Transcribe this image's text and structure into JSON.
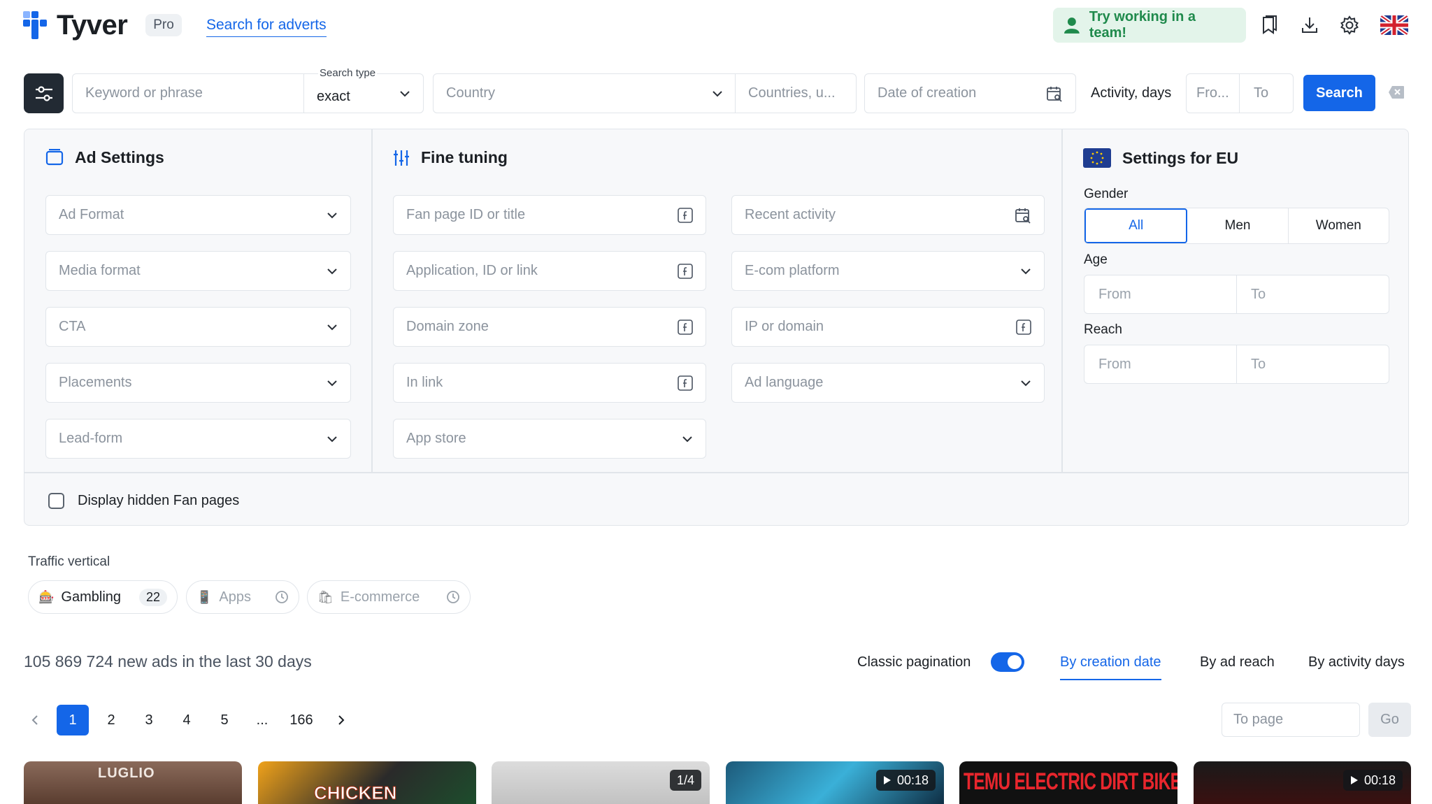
{
  "header": {
    "logo_text": "Tyver",
    "pro_label": "Pro",
    "search_link": "Search for adverts",
    "team_button": "Try working in a team!"
  },
  "search": {
    "keyword_placeholder": "Keyword or phrase",
    "search_type_label": "Search type",
    "search_type_value": "exact",
    "country_placeholder": "Country",
    "countries_placeholder": "Countries, u...",
    "date_placeholder": "Date of creation",
    "activity_label": "Activity, days",
    "activity_from": "Fro...",
    "activity_to": "To",
    "search_button": "Search"
  },
  "ad_settings": {
    "title": "Ad Settings",
    "fields": [
      "Ad Format",
      "Media format",
      "CTA",
      "Placements",
      "Lead-form"
    ]
  },
  "fine_tuning": {
    "title": "Fine tuning",
    "left": [
      "Fan page ID or title",
      "Application, ID or link",
      "Domain zone",
      "In link",
      "App store"
    ],
    "right": [
      "Recent activity",
      "E-com platform",
      "IP or domain",
      "Ad language"
    ]
  },
  "eu_settings": {
    "title": "Settings for EU",
    "gender_label": "Gender",
    "gender_options": [
      "All",
      "Men",
      "Women"
    ],
    "gender_selected": "All",
    "age_label": "Age",
    "reach_label": "Reach",
    "from": "From",
    "to": "To"
  },
  "hidden_fanpages_label": "Display hidden Fan pages",
  "traffic": {
    "label": "Traffic vertical",
    "chips": [
      {
        "label": "Gambling",
        "count": "22"
      },
      {
        "label": "Apps"
      },
      {
        "label": "E-commerce"
      }
    ]
  },
  "results": {
    "stats": "105 869 724 new ads in the last 30 days",
    "classic_pagination": "Classic pagination",
    "classic_pagination_on": true,
    "sorts": [
      "By creation date",
      "By ad reach",
      "By activity days"
    ],
    "sort_selected": "By creation date"
  },
  "pagination": {
    "pages": [
      "1",
      "2",
      "3",
      "4",
      "5",
      "...",
      "166"
    ],
    "current": "1",
    "to_page_placeholder": "To page",
    "go_label": "Go"
  },
  "cards": [
    {
      "overlay_text": "LUGLIO"
    },
    {
      "overlay_text": "CHICKEN"
    },
    {
      "badge": "1/4"
    },
    {
      "badge": "00:18"
    },
    {
      "overlay_text": "TEMU ELECTRIC DIRT BIKE"
    },
    {
      "badge": "00:18"
    }
  ],
  "colors": {
    "accent": "#1466e8",
    "team_bg": "#e3f4ea",
    "team_text": "#1f8a4c",
    "dark_button": "#222a33"
  }
}
